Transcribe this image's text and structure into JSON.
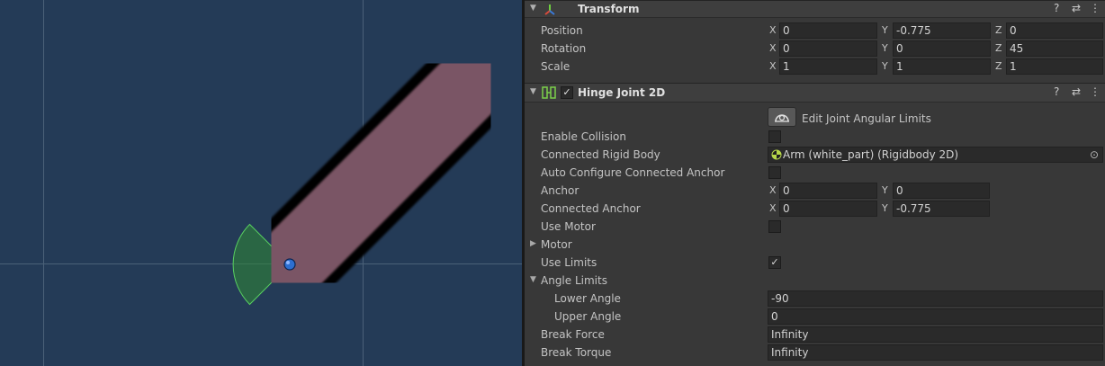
{
  "transform": {
    "title": "Transform",
    "rows": [
      {
        "label": "Position",
        "x": "0",
        "y": "-0.775",
        "z": "0"
      },
      {
        "label": "Rotation",
        "x": "0",
        "y": "0",
        "z": "45"
      },
      {
        "label": "Scale",
        "x": "1",
        "y": "1",
        "z": "1"
      }
    ]
  },
  "hinge": {
    "title": "Hinge Joint 2D",
    "enabled": true,
    "edit_limits_label": "Edit Joint Angular Limits",
    "enable_collision_label": "Enable Collision",
    "connected_rb_label": "Connected Rigid Body",
    "connected_rb_value": "Arm (white_part) (Rigidbody 2D)",
    "auto_configure_label": "Auto Configure Connected Anchor",
    "anchor_label": "Anchor",
    "anchor_x": "0",
    "anchor_y": "0",
    "connected_anchor_label": "Connected Anchor",
    "connected_anchor_x": "0",
    "connected_anchor_y": "-0.775",
    "use_motor_label": "Use Motor",
    "motor_label": "Motor",
    "use_limits_label": "Use Limits",
    "use_limits_checked": true,
    "angle_limits_label": "Angle Limits",
    "lower_angle_label": "Lower Angle",
    "lower_angle": "-90",
    "upper_angle_label": "Upper Angle",
    "upper_angle": "0",
    "break_force_label": "Break Force",
    "break_force": "Infinity",
    "break_torque_label": "Break Torque",
    "break_torque": "Infinity"
  },
  "axes": {
    "x": "X",
    "y": "Y",
    "z": "Z"
  },
  "glyphs": {
    "fold_open": "▼",
    "fold_closed": "▶",
    "check": "✓",
    "help": "?",
    "settings": "⇄",
    "menu": "⋮",
    "target": "⊙"
  },
  "colors": {
    "scene_bg": "#243b57",
    "arm_pink": "#7a5565",
    "limit_green": "#2f8a35",
    "anchor_blue": "#2e6fd0"
  }
}
